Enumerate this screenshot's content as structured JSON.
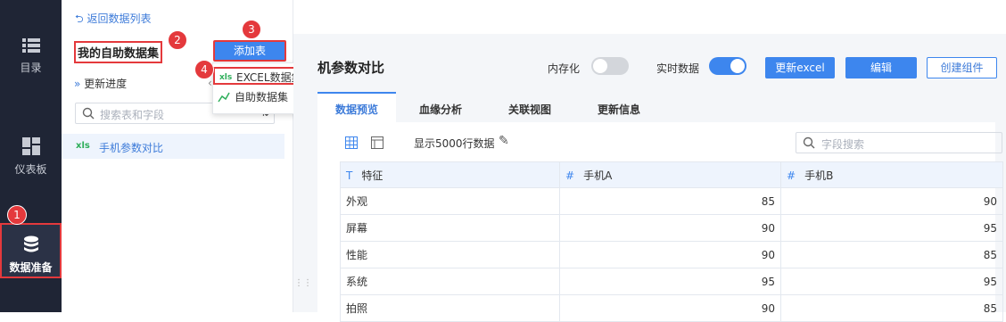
{
  "nav": {
    "items": [
      {
        "label": "目录"
      },
      {
        "label": "仪表板"
      },
      {
        "label": "数据准备"
      }
    ]
  },
  "panel": {
    "back_label": "返回数据列表",
    "dataset_title": "我的自助数据集",
    "add_button": "添加表",
    "progress_label": "更新进度",
    "search_placeholder": "搜索表和字段",
    "dropdown": [
      "EXCEL数据集",
      "自助数据集"
    ],
    "dataset_item": "手机参数对比"
  },
  "badges": [
    "1",
    "2",
    "3",
    "4"
  ],
  "main": {
    "title": "机参数对比",
    "memory_label": "内存化",
    "realtime_label": "实时数据",
    "buttons": [
      "更新excel",
      "编辑",
      "创建组件"
    ],
    "tabs": [
      "数据预览",
      "血缘分析",
      "关联视图",
      "更新信息"
    ],
    "rows_label": "显示5000行数据",
    "field_search_placeholder": "字段搜索"
  },
  "table": {
    "headers": [
      {
        "type_icon": "T",
        "label": "特征"
      },
      {
        "type_icon": "#",
        "label": "手机A"
      },
      {
        "type_icon": "#",
        "label": "手机B"
      }
    ],
    "rows": [
      [
        "外观",
        "85",
        "90"
      ],
      [
        "屏幕",
        "90",
        "95"
      ],
      [
        "性能",
        "90",
        "85"
      ],
      [
        "系统",
        "95",
        "95"
      ],
      [
        "拍照",
        "90",
        "85"
      ]
    ]
  },
  "colors": {
    "accent": "#3d86ee",
    "highlight": "#e4393c",
    "nav_bg": "#1f2535"
  }
}
